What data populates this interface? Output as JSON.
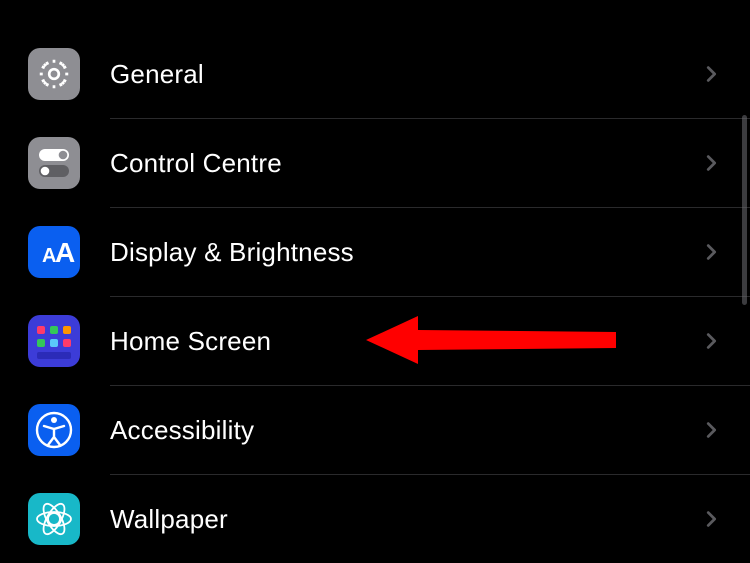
{
  "settings": {
    "items": [
      {
        "key": "general",
        "label": "General"
      },
      {
        "key": "control",
        "label": "Control Centre"
      },
      {
        "key": "display",
        "label": "Display & Brightness"
      },
      {
        "key": "home",
        "label": "Home Screen"
      },
      {
        "key": "accessibility",
        "label": "Accessibility"
      },
      {
        "key": "wallpaper",
        "label": "Wallpaper"
      }
    ]
  },
  "annotation": {
    "target": "home",
    "color": "#ff0000"
  }
}
